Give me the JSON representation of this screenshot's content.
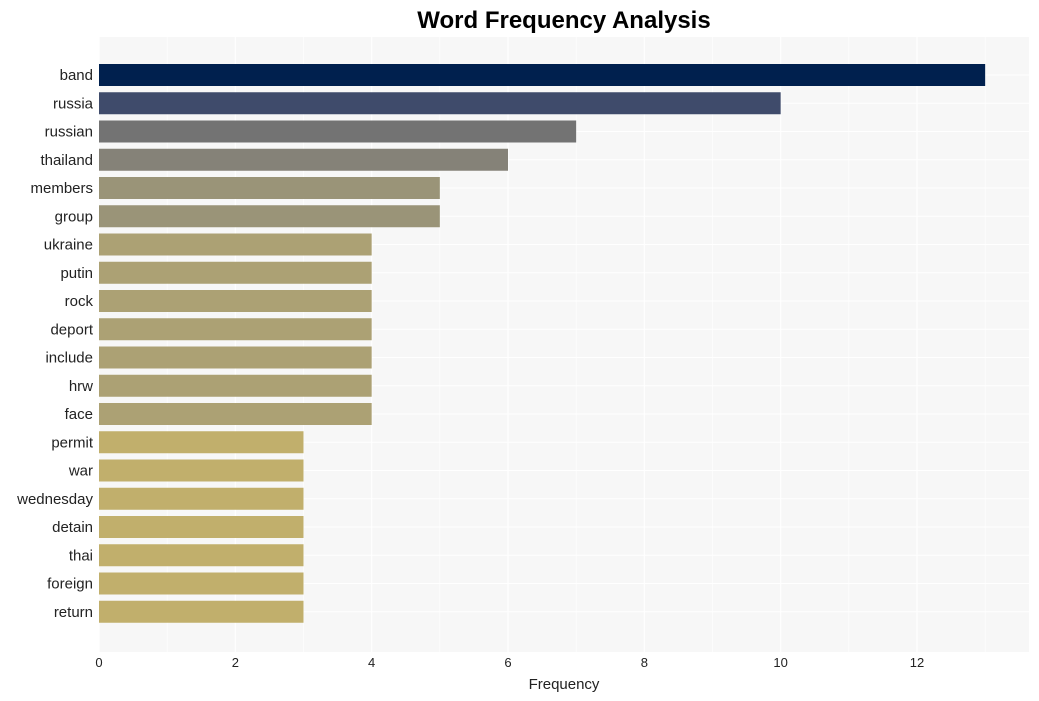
{
  "chart_data": {
    "type": "bar",
    "orientation": "horizontal",
    "title": "Word Frequency Analysis",
    "xlabel": "Frequency",
    "ylabel": "",
    "xlim": [
      0,
      13.6
    ],
    "xticks": [
      0,
      2,
      4,
      6,
      8,
      10,
      12
    ],
    "grid": true,
    "categories": [
      "band",
      "russia",
      "russian",
      "thailand",
      "members",
      "group",
      "ukraine",
      "putin",
      "rock",
      "deport",
      "include",
      "hrw",
      "face",
      "permit",
      "war",
      "wednesday",
      "detain",
      "thai",
      "foreign",
      "return"
    ],
    "values": [
      13,
      10,
      7,
      6,
      5,
      5,
      4,
      4,
      4,
      4,
      4,
      4,
      4,
      3,
      3,
      3,
      3,
      3,
      3,
      3
    ],
    "colors": [
      "#00204e",
      "#3f4b6b",
      "#737373",
      "#858278",
      "#9a9478",
      "#9a9478",
      "#aca174",
      "#aca174",
      "#aca174",
      "#aca174",
      "#aca174",
      "#aca174",
      "#aca174",
      "#c1af6c",
      "#c1af6c",
      "#c1af6c",
      "#c1af6c",
      "#c1af6c",
      "#c1af6c",
      "#c1af6c"
    ]
  }
}
